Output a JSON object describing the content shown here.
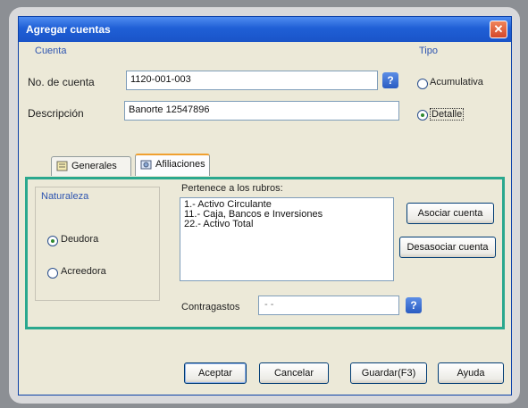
{
  "window": {
    "title": "Agregar cuentas",
    "close_glyph": "✕"
  },
  "cuenta": {
    "group_label": "Cuenta",
    "numero_label": "No. de cuenta",
    "numero_value": "1120-001-003",
    "descripcion_label": "Descripción",
    "descripcion_value": "Banorte 12547896",
    "help_glyph": "?"
  },
  "tipo": {
    "group_label": "Tipo",
    "options": [
      {
        "label": "Acumulativa",
        "checked": false
      },
      {
        "label": "Detalle",
        "checked": true
      }
    ]
  },
  "tabs": [
    {
      "label": "Generales",
      "icon": "general-tab-icon",
      "active": false
    },
    {
      "label": "Afiliaciones",
      "icon": "afiliaciones-tab-icon",
      "active": true
    }
  ],
  "naturaleza": {
    "group_label": "Naturaleza",
    "options": [
      {
        "label": "Deudora",
        "checked": true
      },
      {
        "label": "Acreedora",
        "checked": false
      }
    ]
  },
  "rubros": {
    "label": "Pertenece a los rubros:",
    "items": [
      "1.- Activo Circulante",
      "11.- Caja, Bancos e Inversiones",
      "22.- Activo Total"
    ],
    "asociar_label": "Asociar cuenta",
    "desasociar_label": "Desasociar cuenta"
  },
  "contragastos": {
    "label": "Contragastos",
    "value": "- -",
    "help_glyph": "?"
  },
  "footer": {
    "aceptar": "Aceptar",
    "cancelar": "Cancelar",
    "guardar": "Guardar(F3)",
    "ayuda": "Ayuda"
  }
}
